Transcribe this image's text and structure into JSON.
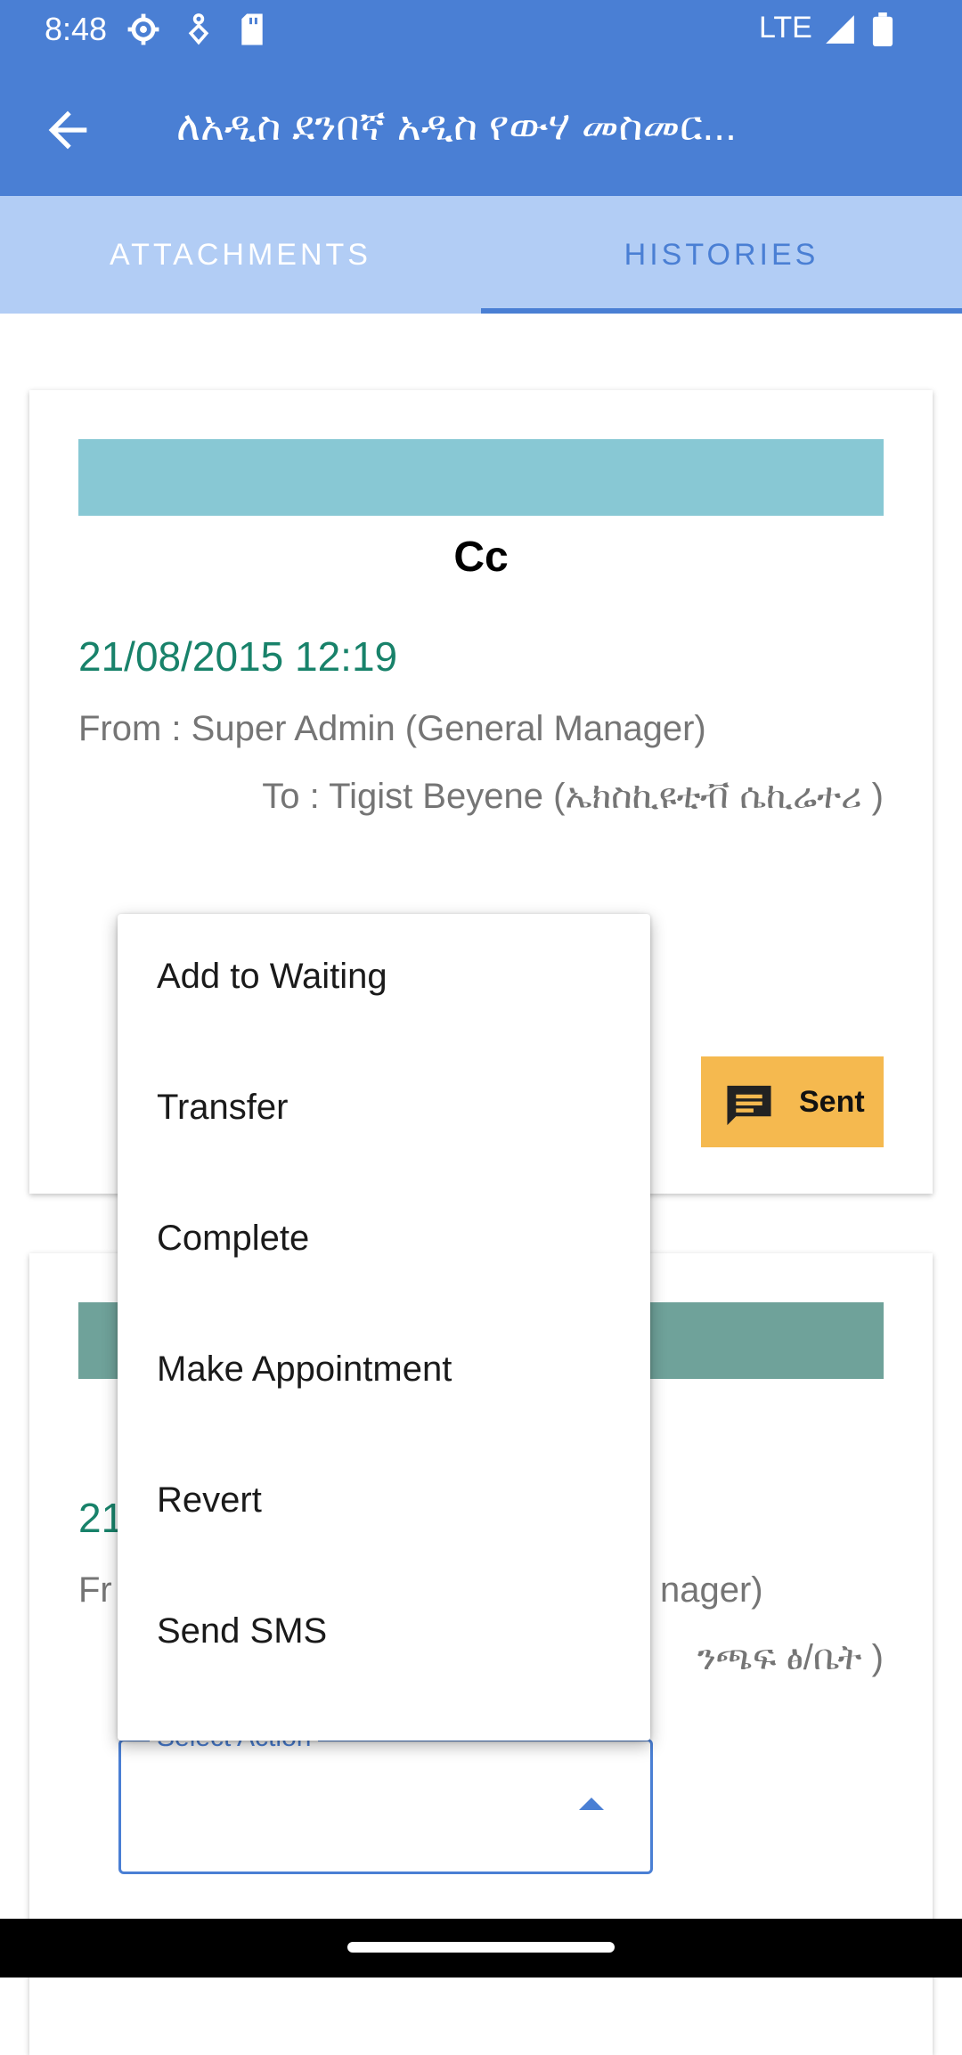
{
  "status_bar": {
    "time": "8:48",
    "network": "LTE",
    "icons": [
      "settings-gear-icon",
      "accessibility-icon",
      "sd-card-icon",
      "signal-icon",
      "battery-icon"
    ]
  },
  "app_bar": {
    "title": "ለአዲስ ደንበኛ አዲስ የውሃ መስመር...",
    "back_icon": "arrow-back-icon"
  },
  "tabs": [
    {
      "label": "ATTACHMENTS",
      "selected": false
    },
    {
      "label": "HISTORIES",
      "selected": true
    }
  ],
  "histories": [
    {
      "type": "Cc",
      "date": "21/08/2015 12:19",
      "from": "From : Super Admin (General Manager)",
      "to": "To : Tigist Beyene (ኤክስኪዩቲቭ ሴኪሬተሪ )",
      "status_button": "Sent",
      "bar_color": "#88c8d4"
    },
    {
      "date_partial": "21",
      "from_partial": "Fr",
      "from_tail": "nager)",
      "to_tail": "ንጫፍ ፅ/ቤት )",
      "bar_color": "#6fa29a"
    }
  ],
  "select_action": {
    "label": "Select Action",
    "value": "",
    "expanded": true
  },
  "action_menu": [
    "Add to Waiting",
    "Transfer",
    "Complete",
    "Make Appointment",
    "Revert",
    "Send SMS"
  ],
  "colors": {
    "primary": "#4a7fd4",
    "tab_bg": "#b2cdf5",
    "date_green": "#18826a",
    "sent_button": "#f5b94f"
  }
}
